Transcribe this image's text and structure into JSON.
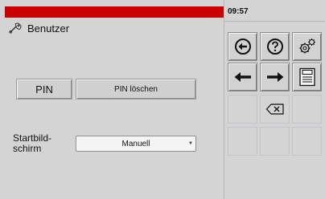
{
  "header": {
    "title": "Benutzer",
    "clock": "09:57"
  },
  "pin": {
    "pin_label": "PIN",
    "clear_label": "PIN löschen"
  },
  "startscreen": {
    "label": "Startbild-\nschirm",
    "value": "Manuell"
  },
  "keypad": {
    "icons": [
      "back-circle-icon",
      "help-icon",
      "gears-icon",
      "arrow-left-icon",
      "arrow-right-icon",
      "save-icon",
      "backspace-icon"
    ]
  },
  "colors": {
    "accent_bar": "#c80000",
    "background": "#d4d4d4"
  }
}
